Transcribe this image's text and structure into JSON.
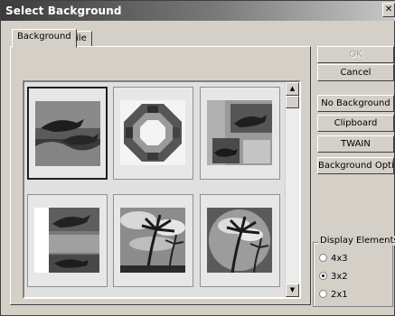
{
  "window": {
    "title": "Select Background",
    "close_glyph": "✕"
  },
  "tabs": [
    {
      "label": "Background",
      "active": true
    },
    {
      "label": "File",
      "active": false
    }
  ],
  "gallery": {
    "thumbnails": [
      {
        "subject": "dolphins jumping over waves",
        "selected": true
      },
      {
        "subject": "octagonal photo frame collage",
        "selected": false
      },
      {
        "subject": "dolphins collage with stone texture",
        "selected": false
      },
      {
        "subject": "dolphins collage left panel",
        "selected": false
      },
      {
        "subject": "palm trees under cloudy sky",
        "selected": false
      },
      {
        "subject": "palm trees with vignette",
        "selected": false
      }
    ],
    "scroll_up_glyph": "▲",
    "scroll_down_glyph": "▼"
  },
  "buttons": {
    "ok": "OK",
    "cancel": "Cancel",
    "no_background": "No Background",
    "clipboard": "Clipboard",
    "twain": "TWAIN",
    "background_options": "Background Options"
  },
  "display_elements": {
    "label": "Display Elements",
    "options": [
      {
        "label": "4x3",
        "checked": false
      },
      {
        "label": "3x2",
        "checked": true
      },
      {
        "label": "2x1",
        "checked": false
      }
    ]
  }
}
